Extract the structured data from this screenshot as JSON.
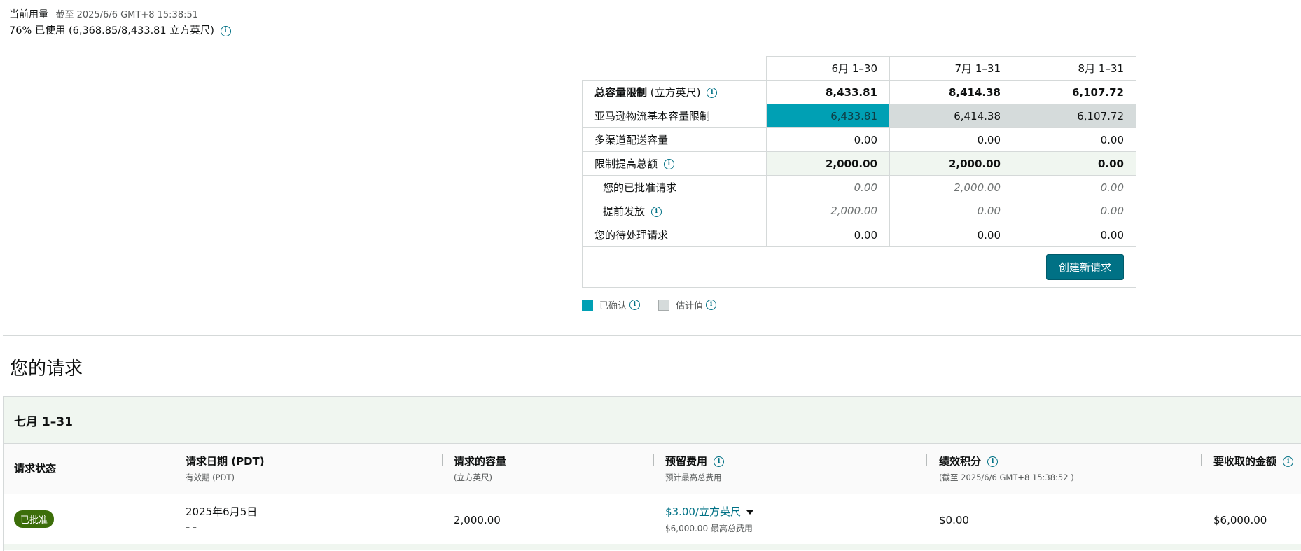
{
  "usage": {
    "label": "当前用量",
    "as_of": "截至 2025/6/6 GMT+8 15:38:51",
    "summary": "76% 已使用 (6,368.85/8,433.81 立方英尺)"
  },
  "capacity": {
    "columns": [
      "6月 1–30",
      "7月 1–31",
      "8月 1–31"
    ],
    "total_label": "总容量限制",
    "total_unit": " (立方英尺)",
    "total": [
      "8,433.81",
      "8,414.38",
      "6,107.72"
    ],
    "base_label": "亚马逊物流基本容量限制",
    "base": [
      "6,433.81",
      "6,414.38",
      "6,107.72"
    ],
    "multichannel_label": "多渠道配送容量",
    "multichannel": [
      "0.00",
      "0.00",
      "0.00"
    ],
    "increase_label": "限制提高总额",
    "increase": [
      "2,000.00",
      "2,000.00",
      "0.00"
    ],
    "approved_label": "您的已批准请求",
    "approved": [
      "0.00",
      "2,000.00",
      "0.00"
    ],
    "early_label": "提前发放",
    "early": [
      "2,000.00",
      "0.00",
      "0.00"
    ],
    "pending_label": "您的待处理请求",
    "pending": [
      "0.00",
      "0.00",
      "0.00"
    ],
    "create_button": "创建新请求"
  },
  "legend": {
    "confirmed": "已确认",
    "estimated": "估计值"
  },
  "colors": {
    "confirmed": "#00a0b4",
    "estimated": "#d5dbdb",
    "accent": "#007185",
    "approved_badge": "#3c6e0a"
  },
  "requests": {
    "title": "您的请求",
    "group": "七月 1–31",
    "headers": {
      "status": "请求状态",
      "date": "请求日期 (PDT)",
      "date_sub": "有效期 (PDT)",
      "volume": "请求的容量",
      "volume_sub": "(立方英尺)",
      "fee": "预留费用",
      "fee_sub": "预计最高总费用",
      "credit": "绩效积分",
      "credit_sub": "(截至 2025/6/6 GMT+8 15:38:52 )",
      "charge": "要收取的金额"
    },
    "row": {
      "status": "已批准",
      "date": "2025年6月5日",
      "validity": "– –",
      "volume": "2,000.00",
      "fee": "$3.00/立方英尺",
      "fee_total": "$6,000.00",
      "fee_total_label": "最高总费用",
      "credit": "$0.00",
      "charge": "$6,000.00"
    }
  }
}
